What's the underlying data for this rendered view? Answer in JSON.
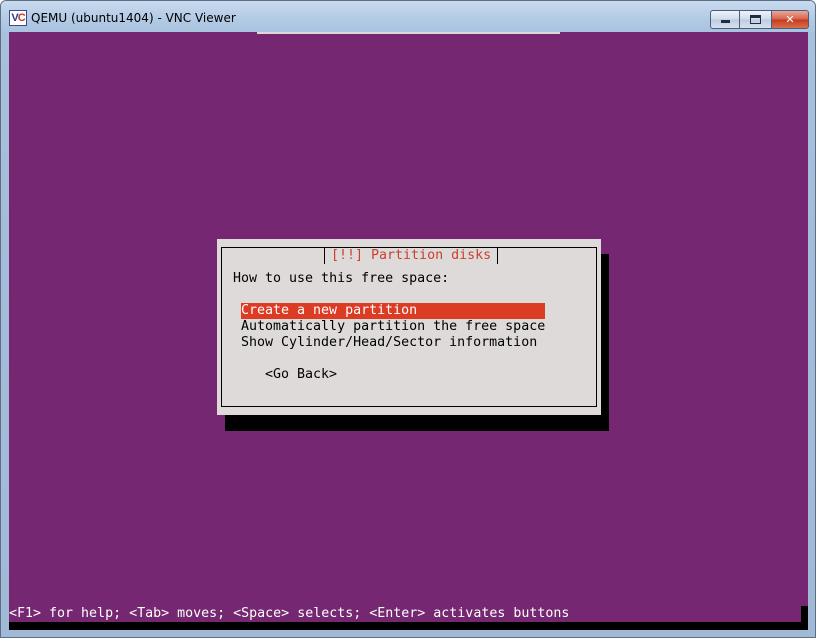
{
  "window": {
    "title": "QEMU (ubuntu1404) - VNC Viewer",
    "icon_label": "V",
    "icon_accent": "C",
    "buttons": {
      "minimize": "minimize-icon",
      "maximize": "maximize-icon",
      "close_label": "✕"
    }
  },
  "dialog": {
    "title": "[!!] Partition disks",
    "prompt": "How to use this free space:",
    "options": [
      "Create a new partition",
      "Automatically partition the free space",
      "Show Cylinder/Head/Sector information"
    ],
    "selected_index": 0,
    "go_back_label": "<Go Back>"
  },
  "status_bar": {
    "text": "<F1> for help; <Tab> moves; <Space> selects; <Enter> activates buttons"
  },
  "colors": {
    "background": "#762771",
    "dialog": "#dedad9",
    "selection": "#dc3b24",
    "title_text": "#c9412d"
  }
}
